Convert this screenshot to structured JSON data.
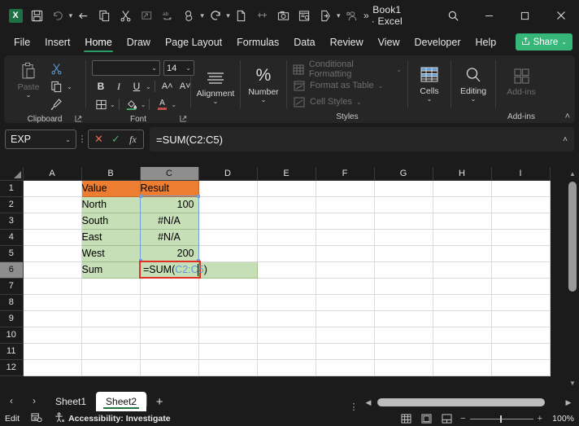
{
  "window": {
    "title": "Book1  ·  Excel",
    "app_icon": "excel-logo-icon",
    "qat": [
      {
        "name": "save-icon",
        "label": "Save"
      },
      {
        "name": "undo-icon",
        "label": "Undo"
      },
      {
        "name": "undo-dropdown-caret",
        "label": "⌄"
      },
      {
        "name": "back-arrow-icon",
        "label": "Back"
      },
      {
        "name": "copy-icon",
        "label": "Copy"
      },
      {
        "name": "cut-icon",
        "label": "Cut"
      },
      {
        "name": "format-painter-icon",
        "label": "Format Painter"
      },
      {
        "name": "spelling-icon",
        "label": "Spelling"
      },
      {
        "name": "touch-mode-icon",
        "label": "Touch/Mouse Mode"
      },
      {
        "name": "touch-dropdown-caret",
        "label": "⌄"
      },
      {
        "name": "redo-icon",
        "label": "Redo"
      },
      {
        "name": "redo-dropdown-caret",
        "label": "⌄"
      },
      {
        "name": "new-file-icon",
        "label": "New"
      },
      {
        "name": "strikethrough-icon",
        "label": "Strikethrough"
      },
      {
        "name": "camera-icon",
        "label": "Camera"
      },
      {
        "name": "print-preview-icon",
        "label": "Print Preview"
      },
      {
        "name": "send-icon",
        "label": "Send"
      },
      {
        "name": "send-dropdown-caret",
        "label": "⌄"
      },
      {
        "name": "permissions-icon",
        "label": "Permissions"
      },
      {
        "name": "qat-overflow-chevrons",
        "label": "»"
      }
    ],
    "minimize_label": "−",
    "maximize_label": "☐",
    "close_label": "✕"
  },
  "ribbon_tabs": [
    {
      "label": "File",
      "active": false
    },
    {
      "label": "Insert",
      "active": false
    },
    {
      "label": "Home",
      "active": true
    },
    {
      "label": "Draw",
      "active": false
    },
    {
      "label": "Page Layout",
      "active": false
    },
    {
      "label": "Formulas",
      "active": false
    },
    {
      "label": "Data",
      "active": false
    },
    {
      "label": "Review",
      "active": false
    },
    {
      "label": "View",
      "active": false
    },
    {
      "label": "Developer",
      "active": false
    },
    {
      "label": "Help",
      "active": false
    }
  ],
  "share": {
    "label": "Share",
    "caret": "⌄",
    "color": "#37b679"
  },
  "ribbon": {
    "collapse_caret": "˄",
    "groups": [
      {
        "label": "Clipboard",
        "has_dialog_launcher": true
      },
      {
        "label": "Font",
        "has_dialog_launcher": true
      },
      {
        "label": "Styles",
        "has_dialog_launcher": false
      },
      {
        "label": "Add-ins",
        "has_dialog_launcher": false
      }
    ],
    "clipboard": {
      "paste_label": "Paste",
      "paste_caret": "⌄",
      "cut_label": "Cut",
      "copy_label": "Copy",
      "copy_caret": "⌄",
      "format_painter_label": "Format Painter"
    },
    "font": {
      "font_name_value": "",
      "font_name_placeholder": "",
      "font_size_value": "14",
      "caret": "⌄",
      "bold_label": "B",
      "italic_label": "I",
      "underline_label": "U",
      "underline_caret": "⌄",
      "increase_size_label": "A˄",
      "decrease_size_label": "A˅",
      "borders_caret": "⌄",
      "fill_caret": "⌄",
      "font_color_label": "A",
      "font_color_caret": "⌄"
    },
    "alignment": {
      "label": "Alignment",
      "caret": "⌄"
    },
    "number": {
      "label": "Number",
      "caret": "⌄",
      "symbol": "%"
    },
    "styles": {
      "conditional_formatting": "Conditional Formatting",
      "conditional_caret": "⌄",
      "format_as_table": "Format as Table",
      "format_caret": "⌄",
      "cell_styles": "Cell Styles",
      "cell_styles_caret": "⌄"
    },
    "cells": {
      "label": "Cells",
      "caret": "⌄"
    },
    "editing": {
      "label": "Editing",
      "caret": "⌄"
    },
    "addins": {
      "label": "Add-ins"
    }
  },
  "formula_bar": {
    "name_box_value": "EXP",
    "name_box_caret": "⌄",
    "more_dots": "⋮",
    "cancel_label": "✕",
    "enter_label": "✓",
    "insert_function_label": "fx",
    "formula_value": "=SUM(C2:C5)",
    "expand_caret": "˄"
  },
  "sheet": {
    "columns": [
      "A",
      "B",
      "C",
      "D",
      "E",
      "F",
      "G",
      "H",
      "I"
    ],
    "selected_column": "C",
    "rows": [
      "1",
      "2",
      "3",
      "4",
      "5",
      "6",
      "7",
      "8",
      "9",
      "10",
      "11",
      "12"
    ],
    "selected_row": "6",
    "cells": [
      {
        "row": "1",
        "A": "",
        "B": "Value",
        "C": "Result",
        "D": "",
        "style_b": "hdr",
        "style_c": "hdr"
      },
      {
        "row": "2",
        "A": "",
        "B": "North",
        "C": "100",
        "D": "",
        "style_b": "grn",
        "style_c": "grn right"
      },
      {
        "row": "3",
        "A": "",
        "B": "South",
        "C": "#N/A",
        "D": "",
        "style_b": "grn",
        "style_c": "grn center"
      },
      {
        "row": "4",
        "A": "",
        "B": "East",
        "C": "#N/A",
        "D": "",
        "style_b": "grn",
        "style_c": "grn center"
      },
      {
        "row": "5",
        "A": "",
        "B": "West",
        "C": "200",
        "D": "",
        "style_b": "grn",
        "style_c": "grn right"
      },
      {
        "row": "6",
        "A": "",
        "B": "Sum",
        "C": "",
        "D": "",
        "style_b": "grn",
        "style_c": "grn",
        "style_d": "grn"
      },
      {
        "row": "7",
        "A": "",
        "B": "",
        "C": "",
        "D": ""
      },
      {
        "row": "8",
        "A": "",
        "B": "",
        "C": "",
        "D": ""
      },
      {
        "row": "9",
        "A": "",
        "B": "",
        "C": "",
        "D": ""
      },
      {
        "row": "10",
        "A": "",
        "B": "",
        "C": "",
        "D": ""
      },
      {
        "row": "11",
        "A": "",
        "B": "",
        "C": "",
        "D": ""
      },
      {
        "row": "12",
        "A": "",
        "B": "",
        "C": "",
        "D": ""
      }
    ],
    "editing_cell": {
      "address": "C6",
      "text_prefix": "=SUM(",
      "text_reference": "C2:C5",
      "text_suffix": ")"
    },
    "selection_range": "C2:C5",
    "colors": {
      "header_fill": "#ed7d31",
      "data_fill": "#c6dfb6",
      "edit_outline": "#e03024",
      "range_outline": "#6f9fd8",
      "reference_text": "#5b9bd5"
    }
  },
  "sheet_tabs": {
    "prev_label": "‹",
    "next_label": "›",
    "tabs": [
      {
        "label": "Sheet1",
        "active": false
      },
      {
        "label": "Sheet2",
        "active": true
      }
    ],
    "add_label": "+"
  },
  "status_bar": {
    "mode": "Edit",
    "macro_icon": "record-macro-icon",
    "accessibility_icon": "accessibility-icon",
    "accessibility_label": "Accessibility: Investigate",
    "views": [
      {
        "name": "normal-view-icon"
      },
      {
        "name": "page-layout-view-icon"
      },
      {
        "name": "page-break-preview-icon"
      }
    ],
    "zoom_out_label": "−",
    "zoom_in_label": "+",
    "zoom_level": "100%"
  }
}
